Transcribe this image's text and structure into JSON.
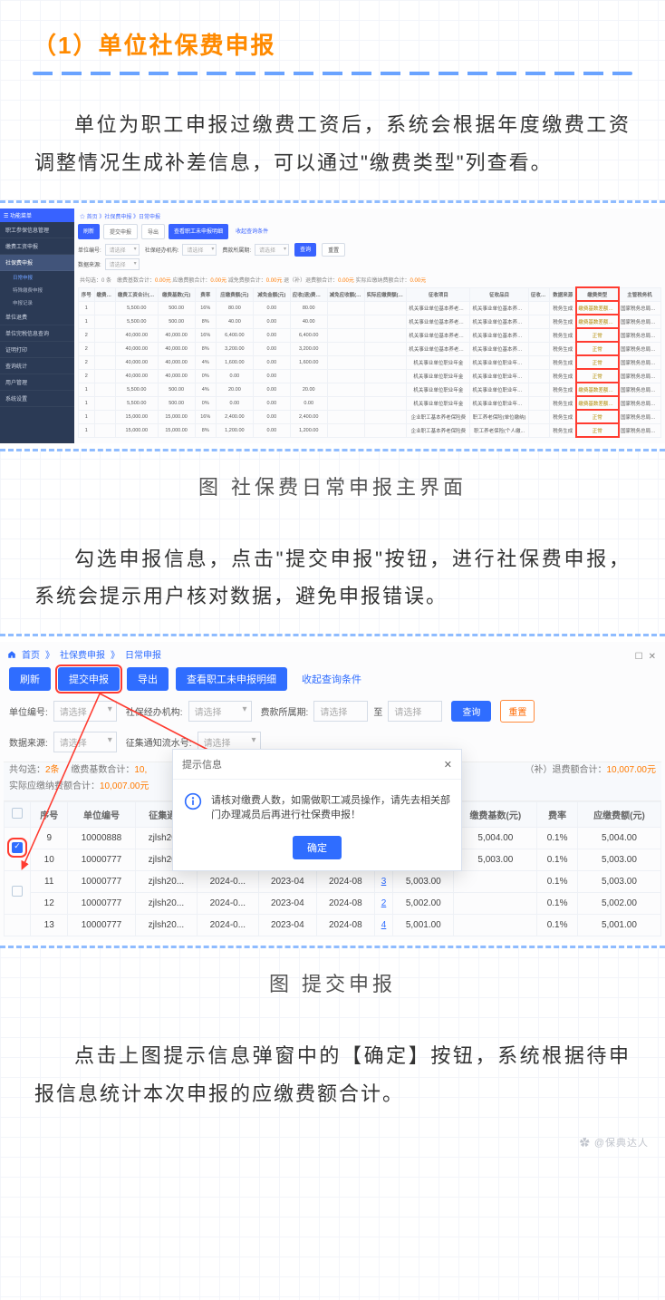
{
  "doc": {
    "heading": "（1）单位社保费申报",
    "para1": "单位为职工申报过缴费工资后，系统会根据年度缴费工资调整情况生成补差信息，可以通过\"缴费类型\"列查看。",
    "caption1": "图 社保费日常申报主界面",
    "para2": "勾选申报信息，点击\"提交申报\"按钮，进行社保费申报，系统会提示用户核对数据，避免申报错误。",
    "caption2": "图 提交申报",
    "para3": "点击上图提示信息弹窗中的【确定】按钮，系统根据待申报信息统计本次申报的应缴费额合计。",
    "watermark": "✿ @保典达人"
  },
  "shot1": {
    "side_header": "☰ 功能菜单",
    "sidebar": [
      "职工参保信息管理",
      "缴费工资申报",
      "社保费申报"
    ],
    "sidebar_sub": [
      "日常申报",
      "特殊缴费申报",
      "申报记录"
    ],
    "sidebar_tail": [
      "单位退费",
      "单位完税信息查询",
      "证明打印",
      "查询统计",
      "用户管理",
      "系统设置"
    ],
    "crumbs": "☆ 首页 》社保费申报 》日常申报",
    "toolbar_buttons": [
      "刷新",
      "提交申报",
      "导出",
      "查看职工未申报明细"
    ],
    "toolbar_link": "收起查询条件",
    "filters": {
      "f1": "单位编号:",
      "f2": "社保经办机构:",
      "f3": "费款所属期:",
      "f4": "数据来源:",
      "ph": "请选择",
      "btn_q": "查询",
      "btn_r": "重置"
    },
    "sumline_pre": "共勾选：0 条　缴费基数合计：",
    "sum_vals": [
      "0.00元",
      "0.00元",
      "0.00元",
      "0.00元",
      "0.00元"
    ],
    "sumline_lbls": [
      "应缴费额合计：",
      "减免费额合计：",
      "退（补）退费额合计：",
      "实际应缴纳费额合计："
    ],
    "headers": [
      "序号",
      "缴费人数",
      "缴费工资合计(元)",
      "缴费基数(元)",
      "费率",
      "应缴费额(元)",
      "减免金额(元)",
      "应收(退)费额(元)",
      "减免应收额(元)",
      "实际应缴费额(元)",
      "征收项目",
      "征收品目",
      "征收子目",
      "数据来源",
      "缴费类型",
      "主管税务机"
    ],
    "rows": [
      {
        "idx": "1",
        "cnt": "",
        "gz": "5,500.00",
        "base": "500.00",
        "rate": "16%",
        "yj": "80.00",
        "jm": "0.00",
        "ys": "80.00",
        "jmys": "",
        "sj": "",
        "xm": "机关事业单位基本养老保险费",
        "pm": "机关事业单位基本养老保...",
        "zm": "",
        "src": "税务生成",
        "type": "缴费基数差额补缴",
        "org": "国家税务总局广宁县"
      },
      {
        "idx": "1",
        "cnt": "",
        "gz": "5,500.00",
        "base": "500.00",
        "rate": "8%",
        "yj": "40.00",
        "jm": "0.00",
        "ys": "40.00",
        "jmys": "",
        "sj": "",
        "xm": "机关事业单位基本养老保险费",
        "pm": "机关事业单位基本养老保...",
        "zm": "",
        "src": "税务生成",
        "type": "缴费基数差额补缴",
        "org": "国家税务总局广宁县"
      },
      {
        "idx": "2",
        "cnt": "",
        "gz": "40,000.00",
        "base": "40,000.00",
        "rate": "16%",
        "yj": "6,400.00",
        "jm": "0.00",
        "ys": "6,400.00",
        "jmys": "",
        "sj": "",
        "xm": "机关事业单位基本养老保险费",
        "pm": "机关事业单位基本养老保...",
        "zm": "",
        "src": "税务生成",
        "type": "正常",
        "org": "国家税务总局广宁县"
      },
      {
        "idx": "2",
        "cnt": "",
        "gz": "40,000.00",
        "base": "40,000.00",
        "rate": "8%",
        "yj": "3,200.00",
        "jm": "0.00",
        "ys": "3,200.00",
        "jmys": "",
        "sj": "",
        "xm": "机关事业单位基本养老保险费",
        "pm": "机关事业单位基本养老保...",
        "zm": "",
        "src": "税务生成",
        "type": "正常",
        "org": "国家税务总局广宁县"
      },
      {
        "idx": "2",
        "cnt": "",
        "gz": "40,000.00",
        "base": "40,000.00",
        "rate": "4%",
        "yj": "1,600.00",
        "jm": "0.00",
        "ys": "1,600.00",
        "jmys": "",
        "sj": "",
        "xm": "机关事业单位职业年金",
        "pm": "机关事业单位职业年金（...",
        "zm": "",
        "src": "税务生成",
        "type": "正常",
        "org": "国家税务总局广宁县"
      },
      {
        "idx": "2",
        "cnt": "",
        "gz": "40,000.00",
        "base": "40,000.00",
        "rate": "0%",
        "yj": "0.00",
        "jm": "0.00",
        "ys": "",
        "jmys": "",
        "sj": "",
        "xm": "机关事业单位职业年金",
        "pm": "机关事业单位职业年金（...",
        "zm": "",
        "src": "税务生成",
        "type": "正常",
        "org": "国家税务总局广宁县"
      },
      {
        "idx": "1",
        "cnt": "",
        "gz": "5,500.00",
        "base": "500.00",
        "rate": "4%",
        "yj": "20.00",
        "jm": "0.00",
        "ys": "20.00",
        "jmys": "",
        "sj": "",
        "xm": "机关事业单位职业年金",
        "pm": "机关事业单位职业年金（...",
        "zm": "",
        "src": "税务生成",
        "type": "缴费基数差额补缴",
        "org": "国家税务总局广宁县"
      },
      {
        "idx": "1",
        "cnt": "",
        "gz": "5,500.00",
        "base": "500.00",
        "rate": "0%",
        "yj": "0.00",
        "jm": "0.00",
        "ys": "0.00",
        "jmys": "",
        "sj": "",
        "xm": "机关事业单位职业年金",
        "pm": "机关事业单位职业年金（...",
        "zm": "",
        "src": "税务生成",
        "type": "缴费基数差额补缴",
        "org": "国家税务总局广宁县"
      },
      {
        "idx": "1",
        "cnt": "",
        "gz": "15,000.00",
        "base": "15,000.00",
        "rate": "16%",
        "yj": "2,400.00",
        "jm": "0.00",
        "ys": "2,400.00",
        "jmys": "",
        "sj": "",
        "xm": "企业职工基本养老保险费",
        "pm": "职工养老保险(单位缴纳)",
        "zm": "",
        "src": "税务生成",
        "type": "正常",
        "org": "国家税务总局广宁县"
      },
      {
        "idx": "1",
        "cnt": "",
        "gz": "15,000.00",
        "base": "15,000.00",
        "rate": "8%",
        "yj": "1,200.00",
        "jm": "0.00",
        "ys": "1,200.00",
        "jmys": "",
        "sj": "",
        "xm": "企业职工基本养老保险费",
        "pm": "职工养老保险(个人缴...",
        "zm": "",
        "src": "税务生成",
        "type": "正常",
        "org": "国家税务总局广宁县"
      }
    ]
  },
  "shot2": {
    "crumbs": [
      "首页",
      "社保费申报",
      "日常申报"
    ],
    "win_ctrl": [
      "☐",
      "✕"
    ],
    "toolbar": {
      "refresh": "刷新",
      "submit": "提交申报",
      "export": "导出",
      "view": "查看职工未申报明细",
      "link": "收起查询条件"
    },
    "filters": {
      "f1": "单位编号:",
      "f2": "社保经办机构:",
      "f3": "费款所属期:",
      "to": "至",
      "f4": "数据来源:",
      "f5": "征集通知流水号:",
      "ph": "请选择",
      "btn_q": "查询",
      "btn_r": "重置"
    },
    "sum": {
      "line1_pre": "共勾选：",
      "line1_cnt": "2条",
      "line1_lbl": "　缴费基数合计：",
      "line1_val": "10,",
      "line2_lbl": "实际应缴纳费额合计：",
      "line2_val": "10,007.00元",
      "right_lbl": "（补）退费额合计：",
      "right_val": "10,007.00元"
    },
    "headers": [
      "",
      "序号",
      "单位编号",
      "征集通...",
      "",
      "",
      "",
      "",
      "",
      "缴费基数(元)",
      "费率",
      "应缴费额(元)"
    ],
    "rows": [
      {
        "ck": true,
        "idx": "9",
        "no": "10000888",
        "zj": "zjlsh20...",
        "d1": "2",
        "d2": "",
        "d3": "",
        "d4": "",
        "d5": "00",
        "base": "5,004.00",
        "rate": "0.1%",
        "yj": "5,004.00"
      },
      {
        "ck": true,
        "idx": "10",
        "no": "10000777",
        "zj": "zjlsh20...",
        "d1": "2",
        "d2": "",
        "d3": "",
        "d4": "",
        "d5": "00",
        "base": "5,003.00",
        "rate": "0.1%",
        "yj": "5,003.00"
      },
      {
        "ck": false,
        "idx": "11",
        "no": "10000777",
        "zj": "zjlsh20...",
        "d1": "2024-0...",
        "d2": "2023-04",
        "d3": "2024-08",
        "d4": "3",
        "d5": "5,003.00",
        "base": "",
        "rate": "0.1%",
        "yj": "5,003.00"
      },
      {
        "ck": false,
        "idx": "12",
        "no": "10000777",
        "zj": "zjlsh20...",
        "d1": "2024-0...",
        "d2": "2023-04",
        "d3": "2024-08",
        "d4": "2",
        "d5": "5,002.00",
        "base": "",
        "rate": "0.1%",
        "yj": "5,002.00"
      },
      {
        "ck": false,
        "idx": "13",
        "no": "10000777",
        "zj": "zjlsh20...",
        "d1": "2024-0...",
        "d2": "2023-04",
        "d3": "2024-08",
        "d4": "4",
        "d5": "5,001.00",
        "base": "",
        "rate": "0.1%",
        "yj": "5,001.00"
      }
    ],
    "modal": {
      "title": "提示信息",
      "body": "请核对缴费人数，如需做职工减员操作，请先去相关部门办理减员后再进行社保费申报！",
      "ok": "确定"
    }
  }
}
